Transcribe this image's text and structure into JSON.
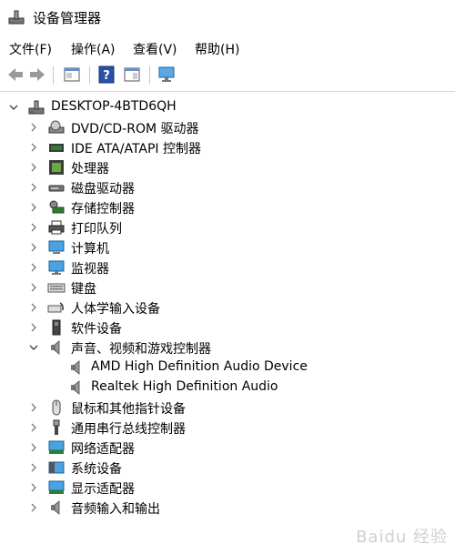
{
  "window": {
    "title": "设备管理器"
  },
  "menu": [
    "文件(F)",
    "操作(A)",
    "查看(V)",
    "帮助(H)"
  ],
  "toolbar": {
    "buttons": [
      "back-arrow-icon",
      "forward-arrow-icon",
      "properties-window-icon",
      "help-icon",
      "device-view-icon",
      "monitor-scan-icon"
    ]
  },
  "tree": {
    "root": "DESKTOP-4BTD6QH",
    "categories": [
      {
        "label": "DVD/CD-ROM 驱动器"
      },
      {
        "label": "IDE ATA/ATAPI 控制器"
      },
      {
        "label": "处理器"
      },
      {
        "label": "磁盘驱动器"
      },
      {
        "label": "存储控制器"
      },
      {
        "label": "打印队列"
      },
      {
        "label": "计算机"
      },
      {
        "label": "监视器"
      },
      {
        "label": "键盘"
      },
      {
        "label": "人体学输入设备"
      },
      {
        "label": "软件设备"
      },
      {
        "label": "声音、视频和游戏控制器"
      },
      {
        "label": "鼠标和其他指针设备"
      },
      {
        "label": "通用串行总线控制器"
      },
      {
        "label": "网络适配器"
      },
      {
        "label": "系统设备"
      },
      {
        "label": "显示适配器"
      },
      {
        "label": "音频输入和输出"
      }
    ],
    "audio_children": [
      "AMD High Definition Audio Device",
      "Realtek High Definition Audio"
    ]
  },
  "watermark": "Baidu 经验"
}
